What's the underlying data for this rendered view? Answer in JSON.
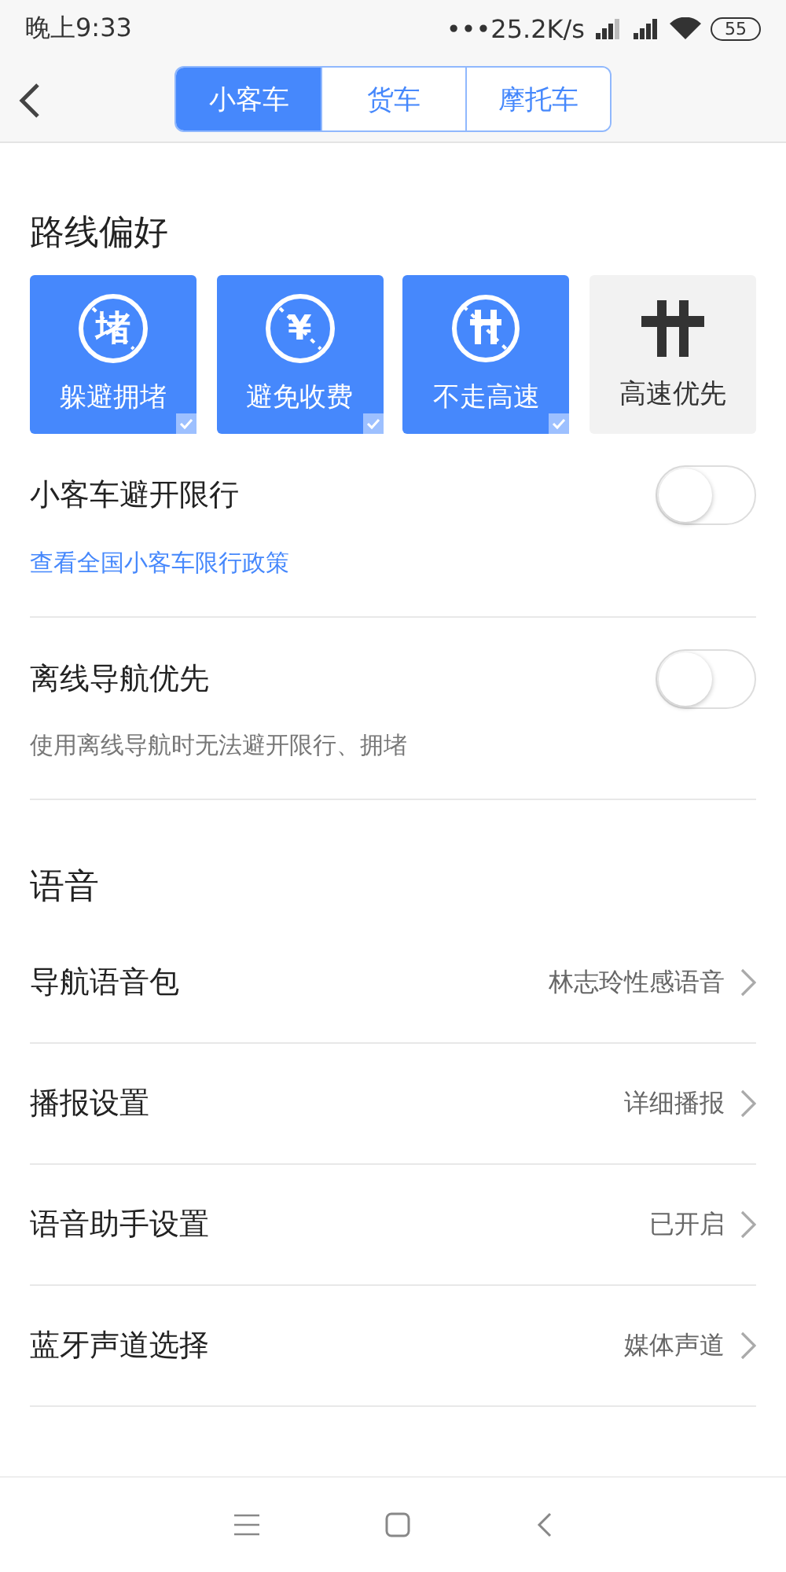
{
  "status_bar": {
    "time": "晚上9:33",
    "dots": "•••",
    "speed": "25.2K/s",
    "battery": "55"
  },
  "tabs": [
    {
      "label": "小客车",
      "selected": true
    },
    {
      "label": "货车",
      "selected": false
    },
    {
      "label": "摩托车",
      "selected": false
    }
  ],
  "route_section": {
    "title": "路线偏好",
    "options": [
      {
        "label": "躲避拥堵",
        "kind": "glyph",
        "glyph": "堵",
        "selected": true
      },
      {
        "label": "避免收费",
        "kind": "glyph",
        "glyph": "¥",
        "selected": true
      },
      {
        "label": "不走高速",
        "kind": "no-highway",
        "selected": true
      },
      {
        "label": "高速优先",
        "kind": "highway",
        "selected": false
      }
    ]
  },
  "toggles": [
    {
      "label": "小客车避开限行",
      "on": false,
      "link": "查看全国小客车限行政策"
    },
    {
      "label": "离线导航优先",
      "on": false,
      "note": "使用离线导航时无法避开限行、拥堵"
    }
  ],
  "voice_section": {
    "title": "语音",
    "rows": [
      {
        "label": "导航语音包",
        "value": "林志玲性感语音"
      },
      {
        "label": "播报设置",
        "value": "详细播报"
      },
      {
        "label": "语音助手设置",
        "value": "已开启"
      },
      {
        "label": "蓝牙声道选择",
        "value": "媒体声道"
      }
    ]
  }
}
